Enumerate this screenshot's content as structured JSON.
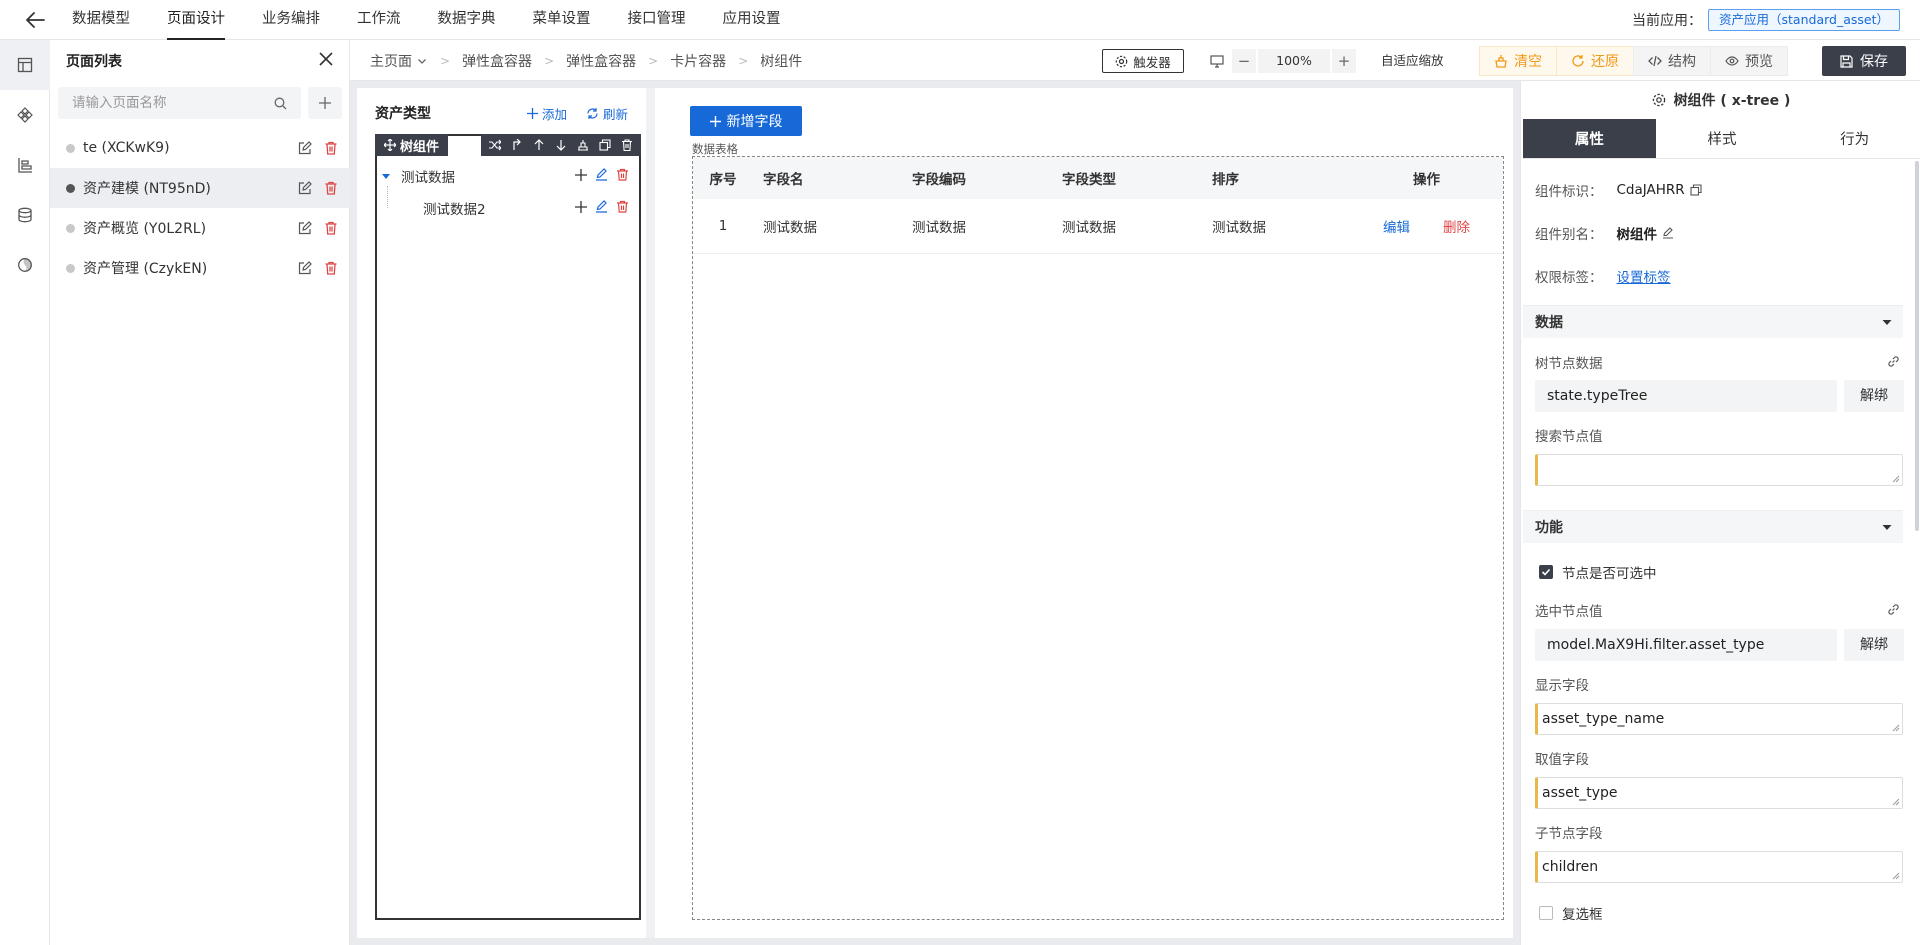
{
  "topnav": {
    "items": [
      "数据模型",
      "页面设计",
      "业务编排",
      "工作流",
      "数据字典",
      "菜单设置",
      "接口管理",
      "应用设置"
    ],
    "active_index": 1,
    "current_app_label": "当前应用：",
    "current_app_value": "资产应用（standard_asset）"
  },
  "icon_rail": [
    "layout-icon",
    "components-icon",
    "outline-icon",
    "database-icon",
    "palette-icon"
  ],
  "pagelist": {
    "title": "页面列表",
    "search_placeholder": "请输入页面名称",
    "items": [
      {
        "name": "te (XCKwK9)",
        "active": false
      },
      {
        "name": "资产建模 (NT95nD)",
        "active": true
      },
      {
        "name": "资产概览 (Y0L2RL)",
        "active": false
      },
      {
        "name": "资产管理 (CzykEN)",
        "active": false
      }
    ]
  },
  "breadcrumb": [
    "主页面",
    "弹性盒容器",
    "弹性盒容器",
    "卡片容器",
    "树组件"
  ],
  "toolbar": {
    "trigger_label": "触发器",
    "zoom": "100%",
    "autofit_label": "自适应缩放",
    "clear_label": "清空",
    "restore_label": "还原",
    "structure_label": "结构",
    "preview_label": "预览",
    "save_label": "保存"
  },
  "tree_card": {
    "title": "资产类型",
    "add_label": "添加",
    "refresh_label": "刷新",
    "tag_label": "树组件",
    "nodes": [
      {
        "label": "测试数据",
        "level": 0
      },
      {
        "label": "测试数据2",
        "level": 1
      }
    ]
  },
  "table_card": {
    "new_field_label": "新增字段",
    "table_label": "数据表格",
    "headers": [
      "序号",
      "字段名",
      "字段编码",
      "字段类型",
      "排序",
      "操作"
    ],
    "rows": [
      {
        "index": "1",
        "name": "测试数据",
        "code": "测试数据",
        "type": "测试数据",
        "sort": "测试数据",
        "edit": "编辑",
        "delete": "删除"
      }
    ]
  },
  "props": {
    "title": "树组件 ( x-tree )",
    "tabs": [
      "属性",
      "样式",
      "行为"
    ],
    "active_tab": 0,
    "id_label": "组件标识：",
    "id_value": "CdaJAHRR",
    "alias_label": "组件别名：",
    "alias_value": "树组件",
    "perm_label": "权限标签：",
    "perm_value": "设置标签",
    "section_data": "数据",
    "tree_data_label": "树节点数据",
    "tree_data_value": "state.typeTree",
    "unbind_label": "解绑",
    "search_label": "搜索节点值",
    "search_value": "",
    "section_func": "功能",
    "selectable_label": "节点是否可选中",
    "selectable_checked": true,
    "selected_label": "选中节点值",
    "selected_value": "model.MaX9Hi.filter.asset_type",
    "display_label": "显示字段",
    "display_value": "asset_type_name",
    "value_label": "取值字段",
    "value_value": "asset_type",
    "children_label": "子节点字段",
    "children_value": "children",
    "checkbox_label": "复选框",
    "checkbox_checked": false
  },
  "colors": {
    "accent": "#1769d8",
    "dark": "#3a3f4a",
    "danger": "#e04545",
    "warn": "#f09a1a"
  }
}
